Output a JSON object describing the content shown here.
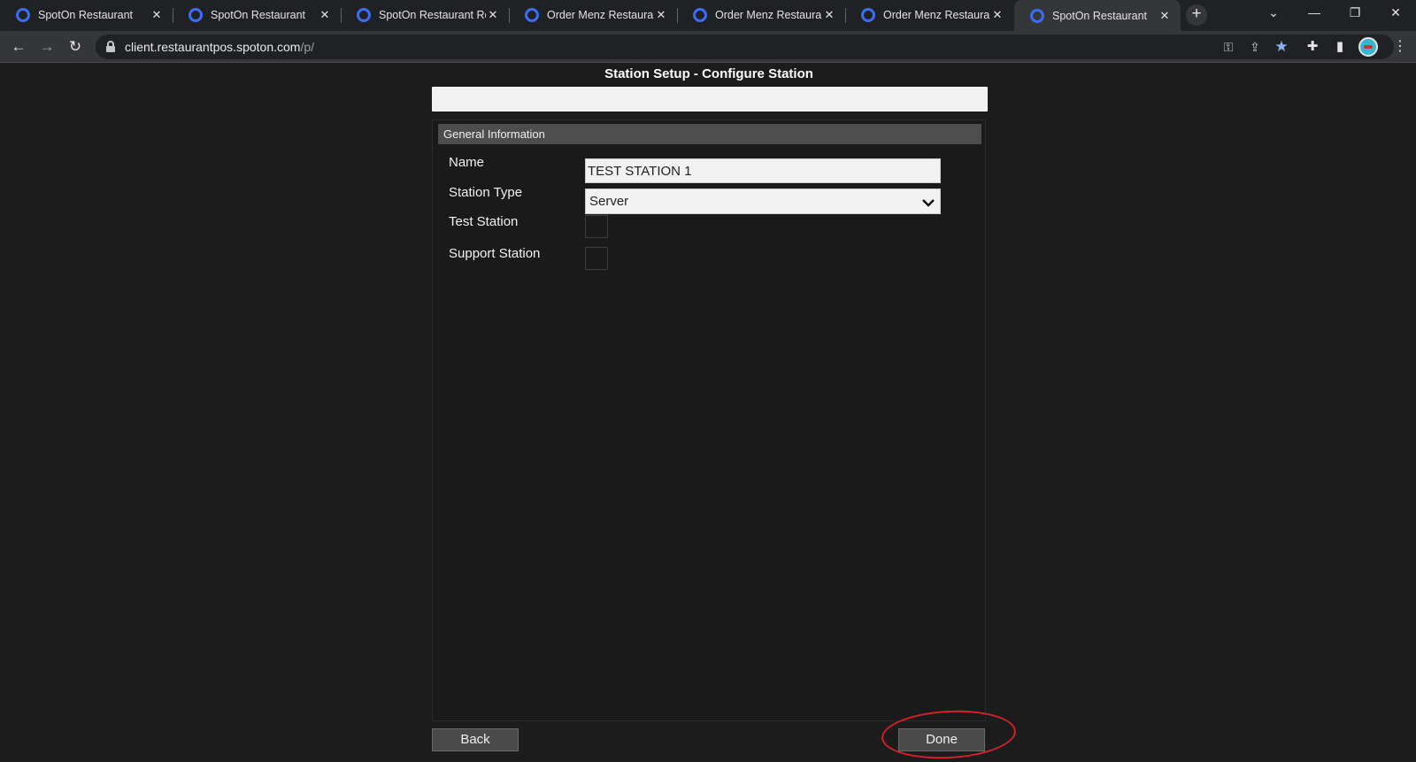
{
  "browser": {
    "tabs": [
      {
        "title": "SpotOn Restaurant",
        "active": false
      },
      {
        "title": "SpotOn Restaurant",
        "active": false
      },
      {
        "title": "SpotOn Restaurant Rep",
        "active": false
      },
      {
        "title": "Order Menz Restaurant",
        "active": false
      },
      {
        "title": "Order Menz Restaurant",
        "active": false
      },
      {
        "title": "Order Menz Restaurant",
        "active": false
      },
      {
        "title": "SpotOn Restaurant",
        "active": true
      }
    ],
    "url_domain": "client.restaurantpos.spoton.com",
    "url_path": "/p/"
  },
  "page": {
    "title": "Station Setup - Configure Station",
    "section_title": "General Information",
    "fields": {
      "name_label": "Name",
      "name_value": "TEST STATION 1",
      "station_type_label": "Station Type",
      "station_type_value": "Server",
      "test_station_label": "Test Station",
      "test_station_checked": false,
      "support_station_label": "Support Station",
      "support_station_checked": false
    },
    "buttons": {
      "back": "Back",
      "done": "Done"
    }
  },
  "colors": {
    "annotation": "#d6202a",
    "favicon": "#3b6cf6"
  }
}
